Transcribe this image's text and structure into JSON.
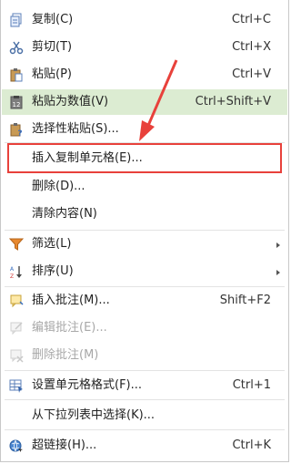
{
  "menu": {
    "copy": {
      "label": "复制(C)",
      "shortcut": "Ctrl+C",
      "icon": "copy-icon"
    },
    "cut": {
      "label": "剪切(T)",
      "shortcut": "Ctrl+X",
      "icon": "scissors-icon"
    },
    "paste": {
      "label": "粘贴(P)",
      "shortcut": "Ctrl+V",
      "icon": "paste-icon"
    },
    "paste_values": {
      "label": "粘贴为数值(V)",
      "shortcut": "Ctrl+Shift+V",
      "icon": "paste-values-icon"
    },
    "paste_special": {
      "label": "选择性粘贴(S)...",
      "icon": "paste-special-icon"
    },
    "insert_copied_cells": {
      "label": "插入复制单元格(E)..."
    },
    "delete": {
      "label": "删除(D)..."
    },
    "clear_contents": {
      "label": "清除内容(N)"
    },
    "filter": {
      "label": "筛选(L)",
      "icon": "filter-icon"
    },
    "sort": {
      "label": "排序(U)",
      "icon": "sort-icon"
    },
    "insert_comment": {
      "label": "插入批注(M)...",
      "shortcut": "Shift+F2",
      "icon": "insert-comment-icon"
    },
    "edit_comment": {
      "label": "编辑批注(E)...",
      "icon": "edit-comment-icon"
    },
    "delete_comment": {
      "label": "删除批注(M)",
      "icon": "delete-comment-icon"
    },
    "format_cells": {
      "label": "设置单元格格式(F)...",
      "shortcut": "Ctrl+1",
      "icon": "format-cells-icon"
    },
    "pick_from_list": {
      "label": "从下拉列表中选择(K)..."
    },
    "hyperlink": {
      "label": "超链接(H)...",
      "shortcut": "Ctrl+K",
      "icon": "hyperlink-icon"
    }
  },
  "colors": {
    "highlight": "#dcecd2",
    "annotation": "#e8413b",
    "disabled_text": "#a8a8a8"
  }
}
